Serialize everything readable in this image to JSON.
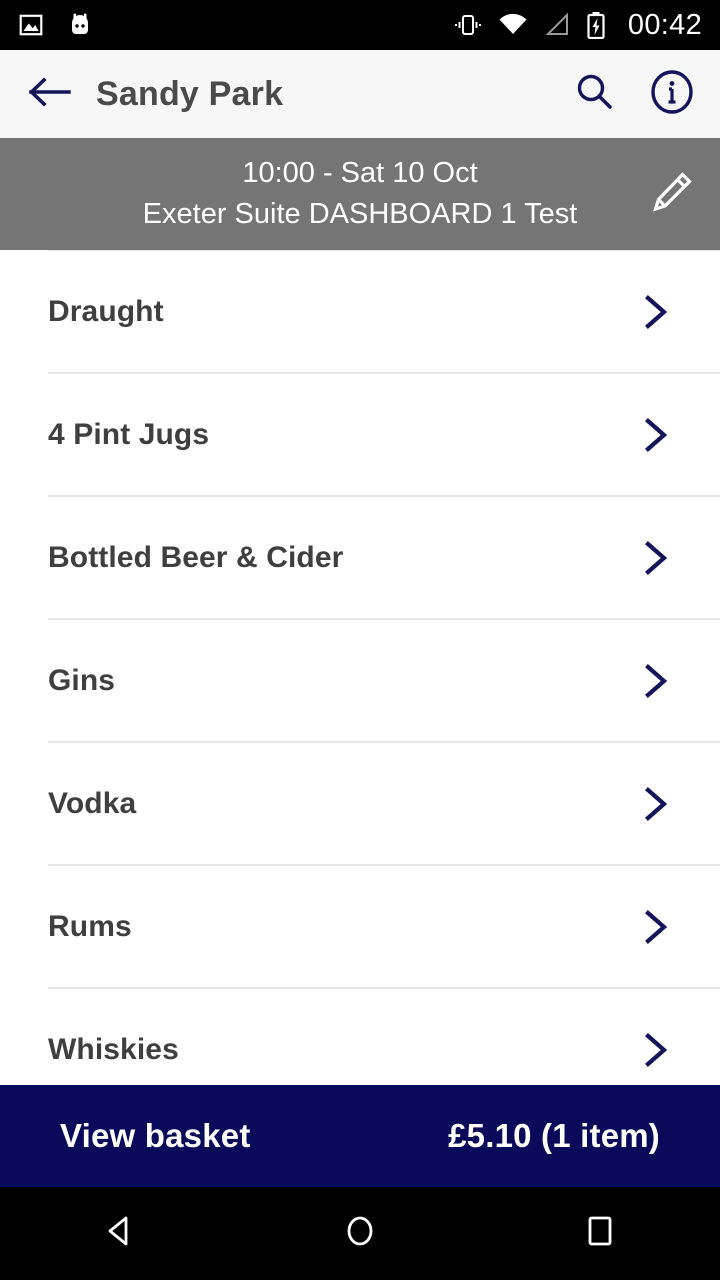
{
  "status_bar": {
    "time": "00:42",
    "left_icons": [
      {
        "name": "photo-icon"
      },
      {
        "name": "android-head-icon"
      }
    ],
    "right_icons": [
      {
        "name": "vibrate-icon"
      },
      {
        "name": "wifi-icon"
      },
      {
        "name": "cell-signal-icon"
      },
      {
        "name": "battery-charging-icon"
      }
    ]
  },
  "app_bar": {
    "back_icon": "arrow-left-icon",
    "title": "Sandy Park",
    "search_icon": "search-icon",
    "info_icon": "info-circle-icon"
  },
  "event_banner": {
    "line1": "10:00 - Sat 10 Oct",
    "line2": "Exeter Suite DASHBOARD 1 Test",
    "edit_icon": "pencil-icon"
  },
  "categories": [
    {
      "label": "Draught",
      "chevron": "chevron-right-icon"
    },
    {
      "label": "4 Pint Jugs",
      "chevron": "chevron-right-icon"
    },
    {
      "label": "Bottled Beer & Cider",
      "chevron": "chevron-right-icon"
    },
    {
      "label": "Gins",
      "chevron": "chevron-right-icon"
    },
    {
      "label": "Vodka",
      "chevron": "chevron-right-icon"
    },
    {
      "label": "Rums",
      "chevron": "chevron-right-icon"
    },
    {
      "label": "Whiskies",
      "chevron": "chevron-right-icon"
    }
  ],
  "basket_bar": {
    "label": "View basket",
    "total": "£5.10 (1 item)"
  },
  "nav_bar": {
    "back": "nav-back-icon",
    "home": "nav-home-icon",
    "recents": "nav-recents-icon"
  },
  "colors": {
    "navy": "#0a0a5a",
    "banner_gray": "#757575",
    "app_bar_bg": "#f7f7f7",
    "text_dark": "#3f3f3f",
    "divider": "#e6e6e6"
  }
}
